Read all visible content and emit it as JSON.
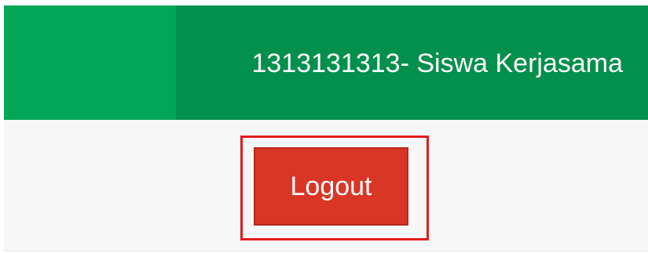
{
  "header": {
    "user_title": "1313131313- Siswa Kerjasama"
  },
  "footer": {
    "logout_label": "Logout"
  },
  "colors": {
    "header_left": "#01a657",
    "header_right": "#038f4c",
    "logout_button": "#d93625",
    "highlight_border": "#e21b1b",
    "footer_background": "#f7f7f7"
  }
}
